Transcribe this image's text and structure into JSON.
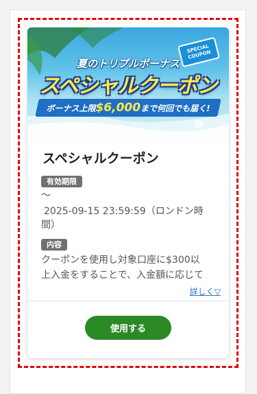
{
  "banner": {
    "subtitle": "夏のトリプルボーナス",
    "title": "スペシャルクーポン",
    "tagline_prefix": "ボーナス上限",
    "tagline_amount": "$6,000",
    "tagline_suffix": "まで何回でも届く!",
    "tag_line1": "SPECIAL",
    "tag_line2": "COUPON"
  },
  "card": {
    "title": "スペシャルクーポン",
    "validity_label": "有効期限",
    "validity_start": "〜",
    "validity_end": "2025-09-15 23:59:59（ロンドン時",
    "validity_end_cont": "間）",
    "content_label": "内容",
    "content_line1": "クーポンを使用し対象口座に$300以",
    "content_line2": "上入金をすることで、入金額に応じて",
    "more_link": "詳しく▽",
    "use_button": "使用する"
  },
  "colors": {
    "dashed_border": "#e00000",
    "button": "#2b8a25",
    "badge": "#707070",
    "link": "#2f78c4"
  }
}
